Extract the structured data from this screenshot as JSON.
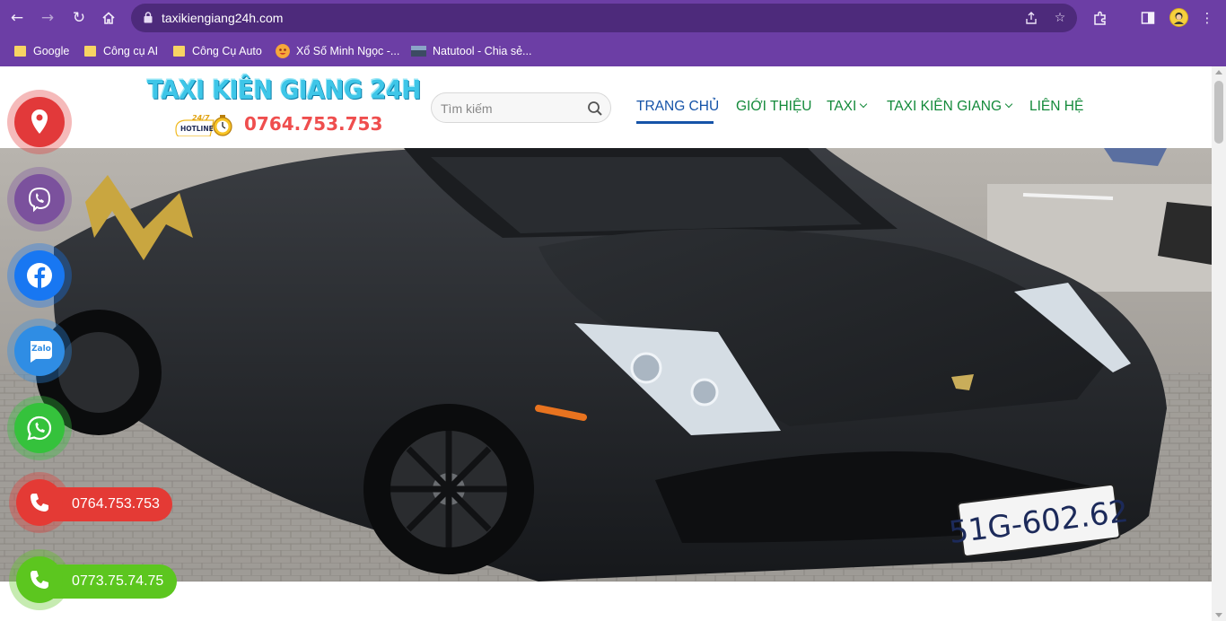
{
  "browser": {
    "url": "taxikiengiang24h.com",
    "bookmarks": [
      {
        "label": "Google",
        "icon": "folder-icon"
      },
      {
        "label": "Công cụ AI",
        "icon": "folder-icon"
      },
      {
        "label": "Công Cụ Auto",
        "icon": "folder-icon"
      },
      {
        "label": "Xổ Số Minh Ngọc -...",
        "icon": "emoji-favicon-icon"
      },
      {
        "label": "Natutool - Chia sẻ...",
        "icon": "image-favicon-icon"
      }
    ]
  },
  "site": {
    "logo_title": "TAXI KIÊN GIANG 24H",
    "logo_badge_top": "24/7",
    "logo_badge_bottom": "HOTLINE",
    "logo_phone": "0764.753.753",
    "search_placeholder": "Tìm kiếm",
    "nav": [
      {
        "label": "TRANG CHỦ",
        "active": true
      },
      {
        "label": "GIỚI THIỆU",
        "active": false
      },
      {
        "label": "TAXI",
        "active": false,
        "dropdown": true
      },
      {
        "label": "TAXI KIÊN GIANG",
        "active": false,
        "dropdown": true
      },
      {
        "label": "LIÊN HỆ",
        "active": false
      }
    ]
  },
  "hero": {
    "plate_text": "51G-602.62"
  },
  "floating": {
    "phone_1": "0764.753.753",
    "phone_2": "0773.75.74.75",
    "zalo_label": "Zalo"
  },
  "colors": {
    "browser_frame": "#6c3ea5",
    "nav_green": "#138a3a",
    "nav_active": "#1553a8",
    "map_red": "#e2393a",
    "viber_purple": "#7b519d",
    "facebook_blue": "#1877f2",
    "zalo_blue": "#2f8de4",
    "whatsapp_green": "#35c23c",
    "hotline_red": "#e43a35",
    "hotline2_green": "#5cc61f"
  }
}
